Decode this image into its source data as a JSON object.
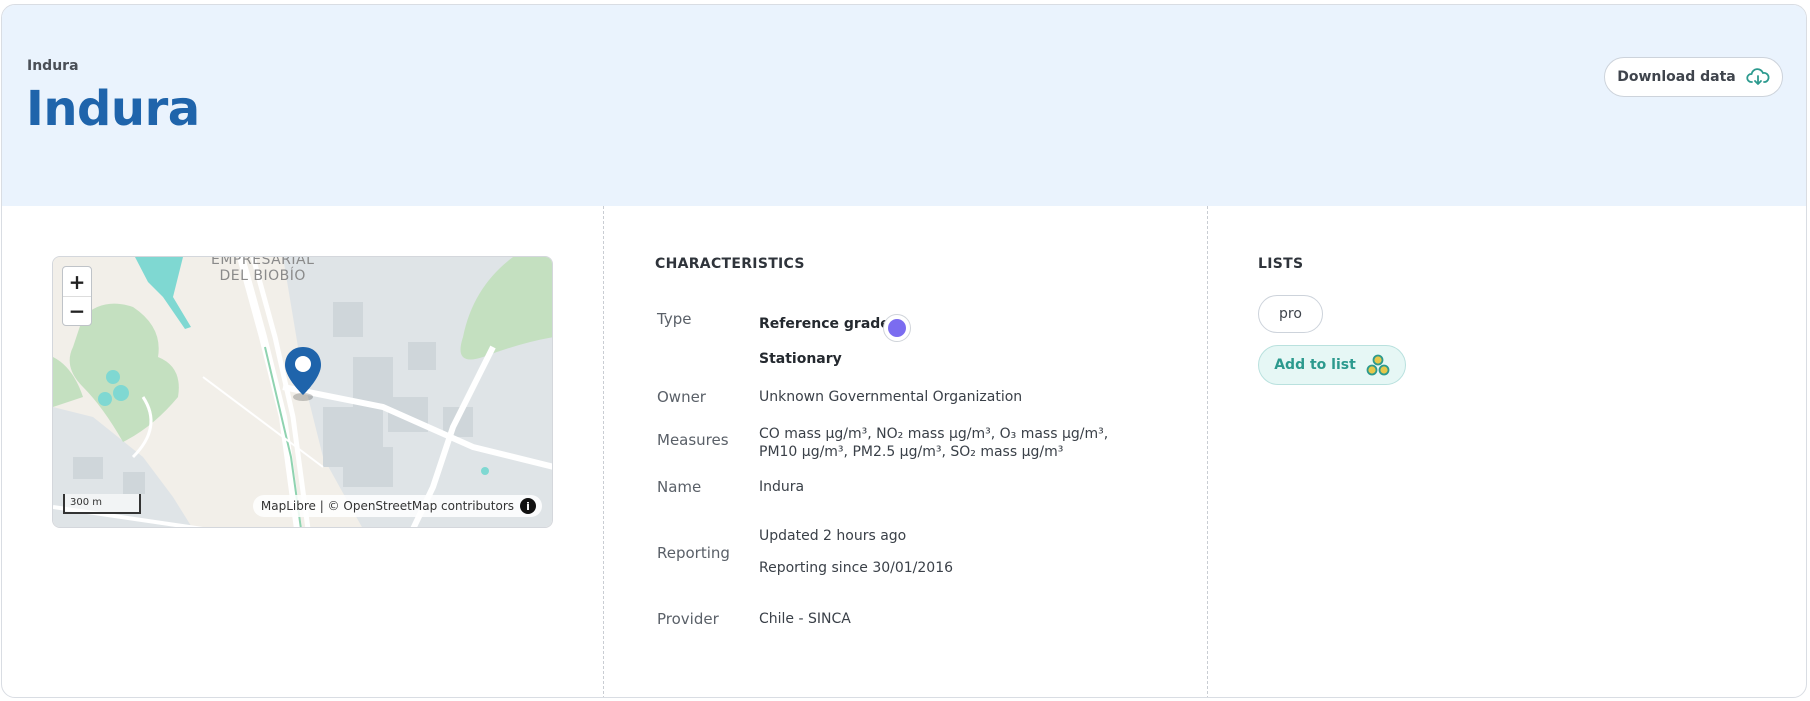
{
  "header": {
    "breadcrumb": "Indura",
    "title": "Indura",
    "download_label": "Download data"
  },
  "map": {
    "zoom_in": "+",
    "zoom_out": "−",
    "scale_label": "300 m",
    "attribution": "MapLibre | © OpenStreetMap contributors",
    "info_glyph": "i",
    "area_label_line1": "EMPRESARIAL",
    "area_label_line2": "DEL BIOBÍO"
  },
  "characteristics": {
    "heading": "CHARACTERISTICS",
    "type_label": "Type",
    "type_grade": "Reference grade",
    "type_mode": "Stationary",
    "owner_label": "Owner",
    "owner_value": "Unknown Governmental Organization",
    "measures_label": "Measures",
    "measures_value": "CO mass µg/m³, NO₂ mass µg/m³, O₃ mass µg/m³, PM10 µg/m³, PM2.5 µg/m³, SO₂ mass µg/m³",
    "name_label": "Name",
    "name_value": "Indura",
    "reporting_label": "Reporting",
    "reporting_updated": "Updated 2 hours ago",
    "reporting_since": "Reporting since 30/01/2016",
    "provider_label": "Provider",
    "provider_value": "Chile - SINCA"
  },
  "lists": {
    "heading": "LISTS",
    "items": [
      "pro"
    ],
    "add_label": "Add to list"
  },
  "colors": {
    "accent_blue": "#1f64ab",
    "reference_grade_dot": "#7b6cf0",
    "teal": "#2c9a8e",
    "header_bg": "#eaf3fd"
  },
  "icons": {
    "download": "cloud-download-icon",
    "add_to_list": "three-circles-icon",
    "marker": "map-pin-icon"
  }
}
